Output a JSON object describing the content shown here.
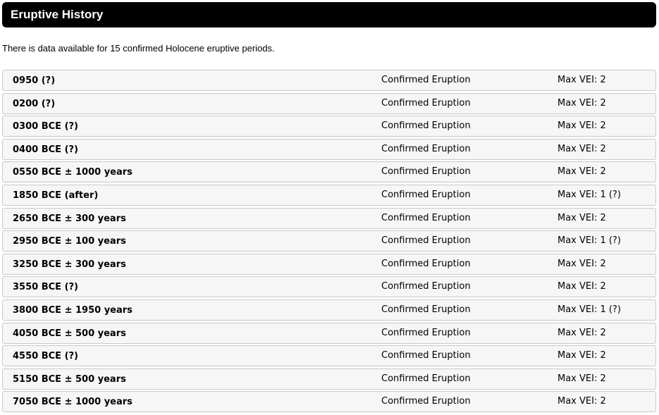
{
  "header": {
    "title": "Eruptive History"
  },
  "intro": {
    "text": "There is data available for 15 confirmed Holocene eruptive periods."
  },
  "eruptions": [
    {
      "date": "0950 (?)",
      "type": "Confirmed Eruption",
      "vei": "Max VEI: 2"
    },
    {
      "date": "0200 (?)",
      "type": "Confirmed Eruption",
      "vei": "Max VEI: 2"
    },
    {
      "date": "0300 BCE (?)",
      "type": "Confirmed Eruption",
      "vei": "Max VEI: 2"
    },
    {
      "date": "0400 BCE (?)",
      "type": "Confirmed Eruption",
      "vei": "Max VEI: 2"
    },
    {
      "date": "0550 BCE ± 1000 years",
      "type": "Confirmed Eruption",
      "vei": "Max VEI: 2"
    },
    {
      "date": "1850 BCE (after)",
      "type": "Confirmed Eruption",
      "vei": "Max VEI: 1 (?)"
    },
    {
      "date": "2650 BCE ± 300 years",
      "type": "Confirmed Eruption",
      "vei": "Max VEI: 2"
    },
    {
      "date": "2950 BCE ± 100 years",
      "type": "Confirmed Eruption",
      "vei": "Max VEI: 1 (?)"
    },
    {
      "date": "3250 BCE ± 300 years",
      "type": "Confirmed Eruption",
      "vei": "Max VEI: 2"
    },
    {
      "date": "3550 BCE (?)",
      "type": "Confirmed Eruption",
      "vei": "Max VEI: 2"
    },
    {
      "date": "3800 BCE ± 1950 years",
      "type": "Confirmed Eruption",
      "vei": "Max VEI: 1 (?)"
    },
    {
      "date": "4050 BCE ± 500 years",
      "type": "Confirmed Eruption",
      "vei": "Max VEI: 2"
    },
    {
      "date": "4550 BCE (?)",
      "type": "Confirmed Eruption",
      "vei": "Max VEI: 2"
    },
    {
      "date": "5150 BCE ± 500 years",
      "type": "Confirmed Eruption",
      "vei": "Max VEI: 2"
    },
    {
      "date": "7050 BCE ± 1000 years",
      "type": "Confirmed Eruption",
      "vei": "Max VEI: 2"
    }
  ]
}
